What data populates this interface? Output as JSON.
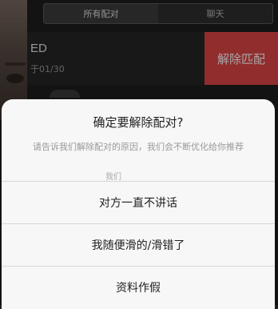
{
  "tabs": [
    {
      "label": "所有配对"
    },
    {
      "label": "聊天"
    }
  ],
  "list": {
    "name": "ED",
    "time": "于01/30",
    "unmatch_label": "解除匹配"
  },
  "dialog": {
    "title": "确定要解除配对?",
    "message": "请告诉我们解除配对的原因，我们会不断优化给你推荐",
    "message_tail": "我们",
    "options": [
      {
        "label": "对方一直不讲话"
      },
      {
        "label": "我随便滑的/滑错了"
      },
      {
        "label": "资料作假"
      }
    ]
  }
}
